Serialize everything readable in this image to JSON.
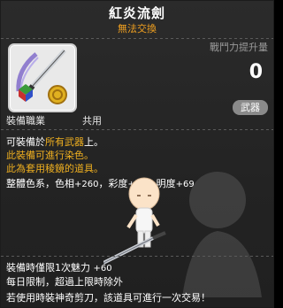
{
  "item": {
    "name": "紅炎流劍",
    "trade_status": "無法交換",
    "combat_power_label": "戰鬥力提升量",
    "combat_power_value": "0",
    "job_label": "裝備職業",
    "job_value": "共用",
    "category_badge": "武器",
    "icon_name": "sword-icon"
  },
  "description": {
    "line1_prefix": "可裝備於",
    "line1_highlight": "所有武器",
    "line1_suffix": "上。",
    "line2": "此裝備可進行染色。",
    "line3": "此為套用稜鏡的道具。",
    "line4_prefix": "整體色系，色相",
    "line4_hue": "+260",
    "line4_sat_label": "，彩度",
    "line4_sat": "+99",
    "line4_bri_label": "，明度",
    "line4_bri": "+69"
  },
  "bonus": {
    "line1_label": "裝備時僅限1次魅力",
    "line1_value": "+60",
    "line2": "每日限制，超過上限時除外",
    "line3": "若使用時裝神奇剪刀，該道具可進行一次交易！"
  },
  "colors": {
    "accent_orange": "#f0b020",
    "title_white": "#ffffff",
    "badge_gray": "#8a8a8a"
  }
}
